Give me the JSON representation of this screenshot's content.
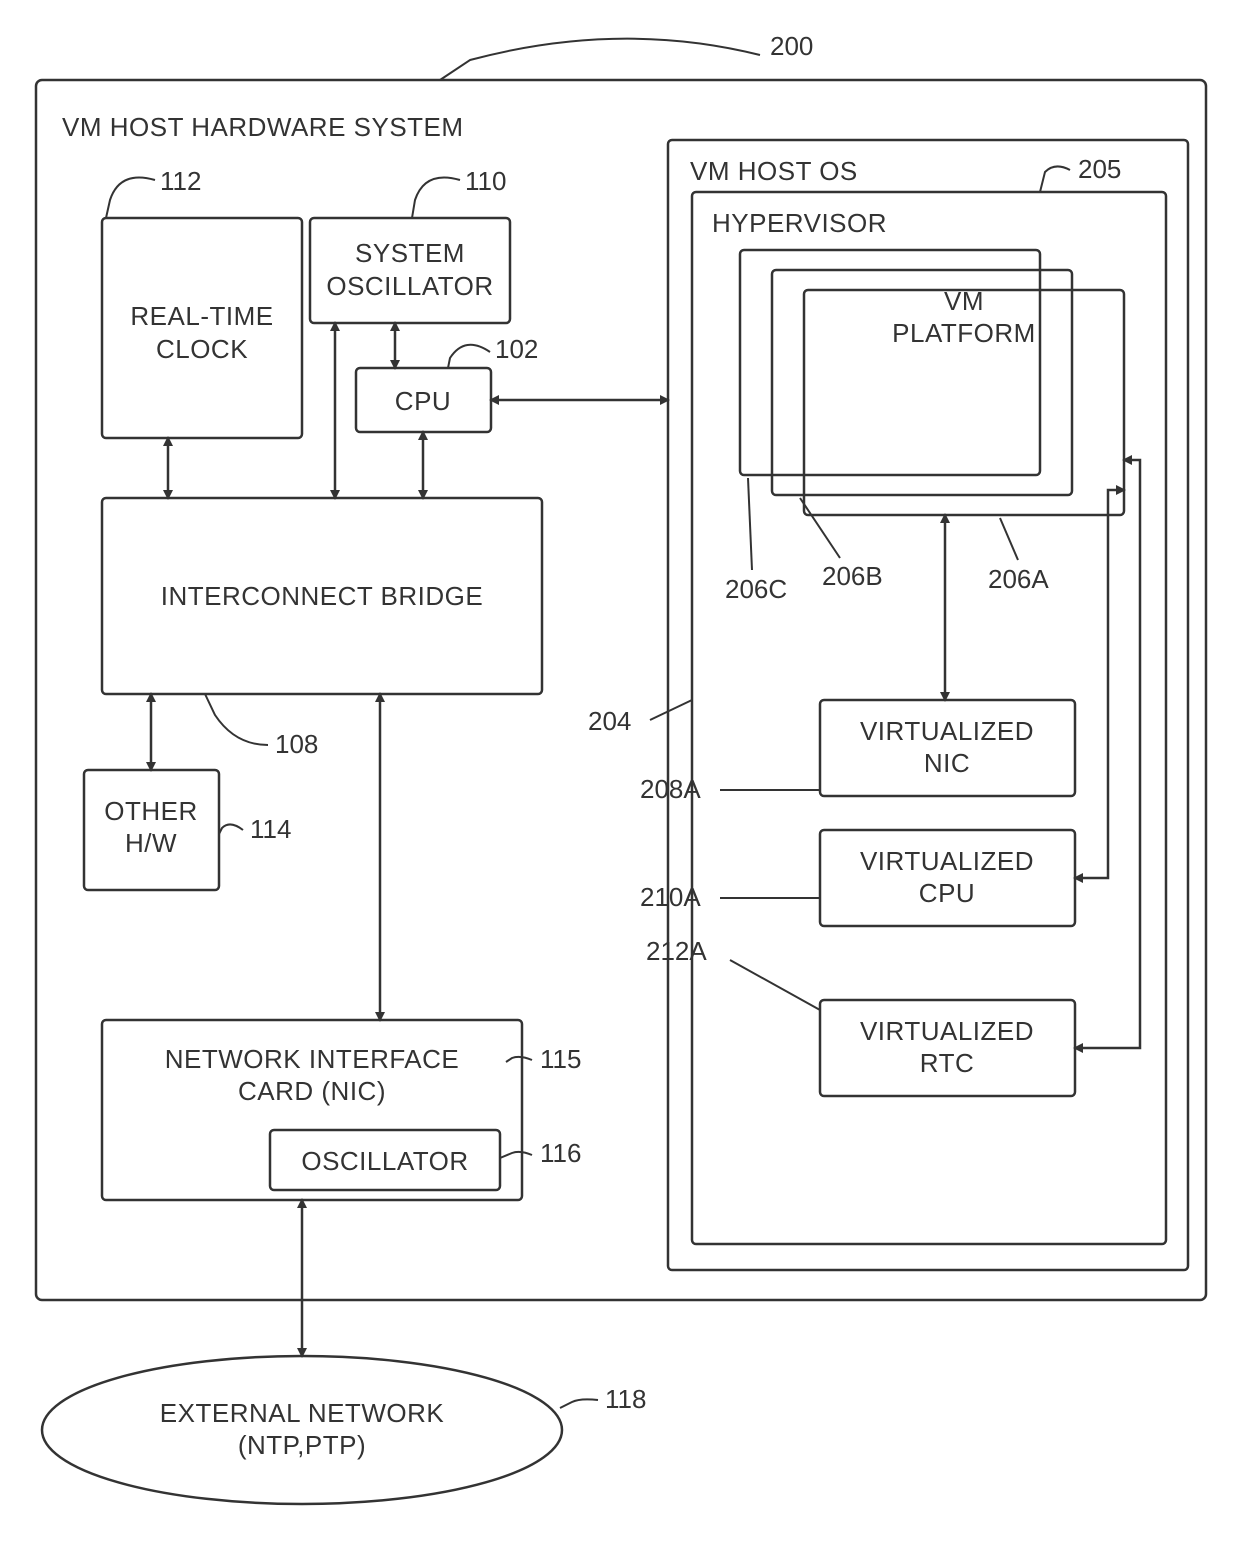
{
  "title": "VM HOST HARDWARE SYSTEM",
  "os_title": "VM HOST OS",
  "hypervisor_title": "HYPERVISOR",
  "blocks": {
    "rtc": {
      "l1": "REAL-TIME",
      "l2": "CLOCK"
    },
    "sysosc": {
      "l1": "SYSTEM",
      "l2": "OSCILLATOR"
    },
    "cpu": "CPU",
    "bridge": "INTERCONNECT BRIDGE",
    "other": {
      "l1": "OTHER",
      "l2": "H/W"
    },
    "nic": {
      "l1": "NETWORK INTERFACE",
      "l2": "CARD (NIC)"
    },
    "osc": "OSCILLATOR",
    "vmplat": {
      "l1": "VM",
      "l2": "PLATFORM"
    },
    "vnic": {
      "l1": "VIRTUALIZED",
      "l2": "NIC"
    },
    "vcpu": {
      "l1": "VIRTUALIZED",
      "l2": "CPU"
    },
    "vrtc": {
      "l1": "VIRTUALIZED",
      "l2": "RTC"
    },
    "ext": {
      "l1": "EXTERNAL NETWORK",
      "l2": "(NTP,PTP)"
    }
  },
  "refs": {
    "r200": "200",
    "r112": "112",
    "r110": "110",
    "r102": "102",
    "r108": "108",
    "r114": "114",
    "r115": "115",
    "r116": "116",
    "r118": "118",
    "r205": "205",
    "r204": "204",
    "r206a": "206A",
    "r206b": "206B",
    "r206c": "206C",
    "r208a": "208A",
    "r210a": "210A",
    "r212a": "212A"
  }
}
